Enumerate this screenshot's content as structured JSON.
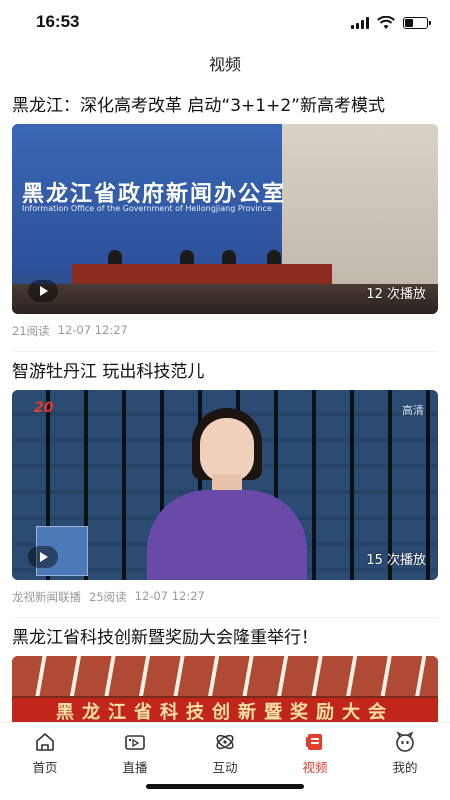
{
  "status_bar": {
    "time": "16:53"
  },
  "header": {
    "title": "视频"
  },
  "feed": [
    {
      "title": "黑龙江：深化高考改革 启动“3+1+2”新高考模式",
      "thumb_banner": "黑龙江省政府新闻办公室",
      "thumb_banner_sub": "Information Office of the Government of Heilongjiang Province",
      "play_count": "12 次播放",
      "source": "",
      "reads": "21阅读",
      "time": "12-07 12:27"
    },
    {
      "title": "智游牡丹江 玩出科技范儿",
      "thumb_tag": "20",
      "thumb_hd": "高清",
      "play_count": "15 次播放",
      "source": "龙视新闻联播",
      "reads": "25阅读",
      "time": "12-07 12:27"
    },
    {
      "title": "黑龙江省科技创新暨奖励大会隆重举行！",
      "thumb_banner": "黑龙江省科技创新暨奖励大会"
    }
  ],
  "tabbar": {
    "active_color": "#e33d2e",
    "items": [
      {
        "label": "首页",
        "icon": "home-icon"
      },
      {
        "label": "直播",
        "icon": "live-camera-icon"
      },
      {
        "label": "互动",
        "icon": "interaction-icon"
      },
      {
        "label": "视频",
        "icon": "video-icon",
        "active": true
      },
      {
        "label": "我的",
        "icon": "profile-icon"
      }
    ]
  }
}
